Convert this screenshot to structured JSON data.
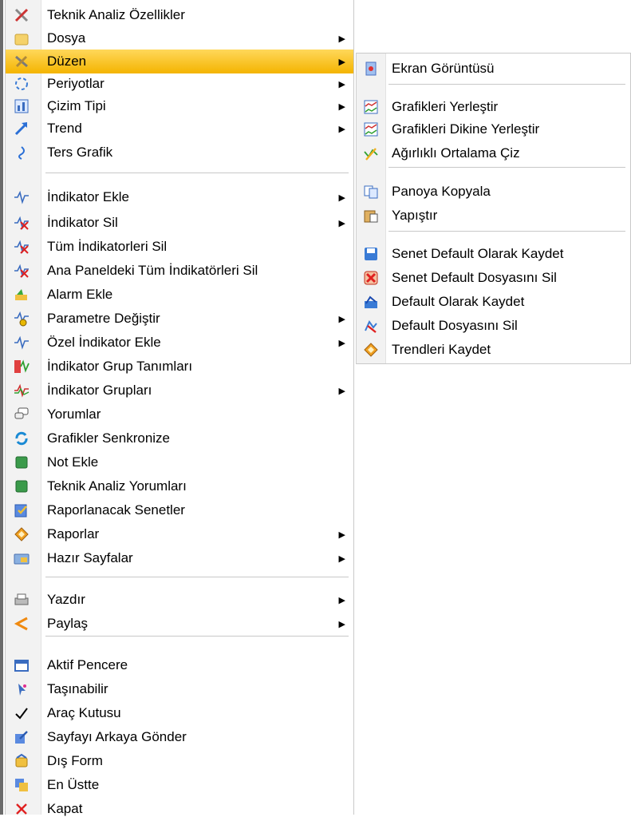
{
  "main_menu": {
    "items": [
      {
        "label": "Teknik Analiz Özellikler",
        "icon": "tools-icon",
        "submenu": false
      },
      {
        "label": "Dosya",
        "icon": "folder-icon",
        "submenu": true
      },
      {
        "label": "Düzen",
        "icon": "wrench-icon",
        "submenu": true,
        "active": true
      },
      {
        "label": "Periyotlar",
        "icon": "period-icon",
        "submenu": true
      },
      {
        "label": "Çizim Tipi",
        "icon": "chart-type-icon",
        "submenu": true
      },
      {
        "label": "Trend",
        "icon": "trend-arrow-icon",
        "submenu": true
      },
      {
        "label": "Ters Grafik",
        "icon": "reverse-icon",
        "submenu": false
      },
      {
        "label": "İndikator Ekle",
        "icon": "indicator-add-icon",
        "submenu": true
      },
      {
        "label": "İndikator Sil",
        "icon": "indicator-delete-icon",
        "submenu": true
      },
      {
        "label": "Tüm İndikatorleri Sil",
        "icon": "indicator-delete-all-icon",
        "submenu": false
      },
      {
        "label": "Ana Paneldeki Tüm İndikatörleri Sil",
        "icon": "indicator-delete-panel-icon",
        "submenu": false
      },
      {
        "label": "Alarm Ekle",
        "icon": "alarm-icon",
        "submenu": false
      },
      {
        "label": "Parametre Değiştir",
        "icon": "parameter-icon",
        "submenu": true
      },
      {
        "label": "Özel İndikator Ekle",
        "icon": "custom-indicator-icon",
        "submenu": true
      },
      {
        "label": "İndikator Grup Tanımları",
        "icon": "indicator-group-def-icon",
        "submenu": false
      },
      {
        "label": "İndikator Grupları",
        "icon": "indicator-groups-icon",
        "submenu": true
      },
      {
        "label": "Yorumlar",
        "icon": "comments-icon",
        "submenu": false
      },
      {
        "label": "Grafikler Senkronize",
        "icon": "sync-icon",
        "submenu": false
      },
      {
        "label": "Not Ekle",
        "icon": "note-icon",
        "submenu": false
      },
      {
        "label": "Teknik Analiz Yorumları",
        "icon": "analysis-note-icon",
        "submenu": false
      },
      {
        "label": "Raporlanacak Senetler",
        "icon": "report-list-icon",
        "submenu": false
      },
      {
        "label": "Raporlar",
        "icon": "reports-icon",
        "submenu": true
      },
      {
        "label": "Hazır Sayfalar",
        "icon": "pages-folder-icon",
        "submenu": true
      },
      {
        "label": "Yazdır",
        "icon": "printer-icon",
        "submenu": true
      },
      {
        "label": "Paylaş",
        "icon": "share-icon",
        "submenu": true
      },
      {
        "label": "Aktif Pencere",
        "icon": "window-icon",
        "submenu": false
      },
      {
        "label": "Taşınabilir",
        "icon": "pin-icon",
        "submenu": false
      },
      {
        "label": "Araç Kutusu",
        "icon": "check-icon",
        "submenu": false
      },
      {
        "label": "Sayfayı Arkaya Gönder",
        "icon": "send-back-icon",
        "submenu": false
      },
      {
        "label": "Dış Form",
        "icon": "external-form-icon",
        "submenu": false
      },
      {
        "label": "En Üstte",
        "icon": "on-top-icon",
        "submenu": false
      },
      {
        "label": "Kapat",
        "icon": "close-icon",
        "submenu": false
      }
    ]
  },
  "sub_menu": {
    "items": [
      {
        "label": "Ekran Görüntüsü",
        "icon": "screenshot-icon"
      },
      {
        "label": "Grafikleri Yerleştir",
        "icon": "arrange-charts-icon"
      },
      {
        "label": "Grafikleri Dikine Yerleştir",
        "icon": "arrange-vertical-icon"
      },
      {
        "label": "Ağırlıklı Ortalama Çiz",
        "icon": "weighted-average-icon"
      },
      {
        "label": "Panoya Kopyala",
        "icon": "copy-icon"
      },
      {
        "label": "Yapıştır",
        "icon": "paste-icon"
      },
      {
        "label": "Senet Default Olarak Kaydet",
        "icon": "save-icon"
      },
      {
        "label": "Senet Default Dosyasını Sil",
        "icon": "delete-icon"
      },
      {
        "label": "Default Olarak Kaydet",
        "icon": "save-default-icon"
      },
      {
        "label": "Default Dosyasını Sil",
        "icon": "delete-default-icon"
      },
      {
        "label": "Trendleri Kaydet",
        "icon": "save-trends-icon"
      }
    ]
  },
  "colors": {
    "active_highlight": "#f4b400",
    "separator": "#c8c8c8",
    "gutter": "#f2f2f2"
  }
}
